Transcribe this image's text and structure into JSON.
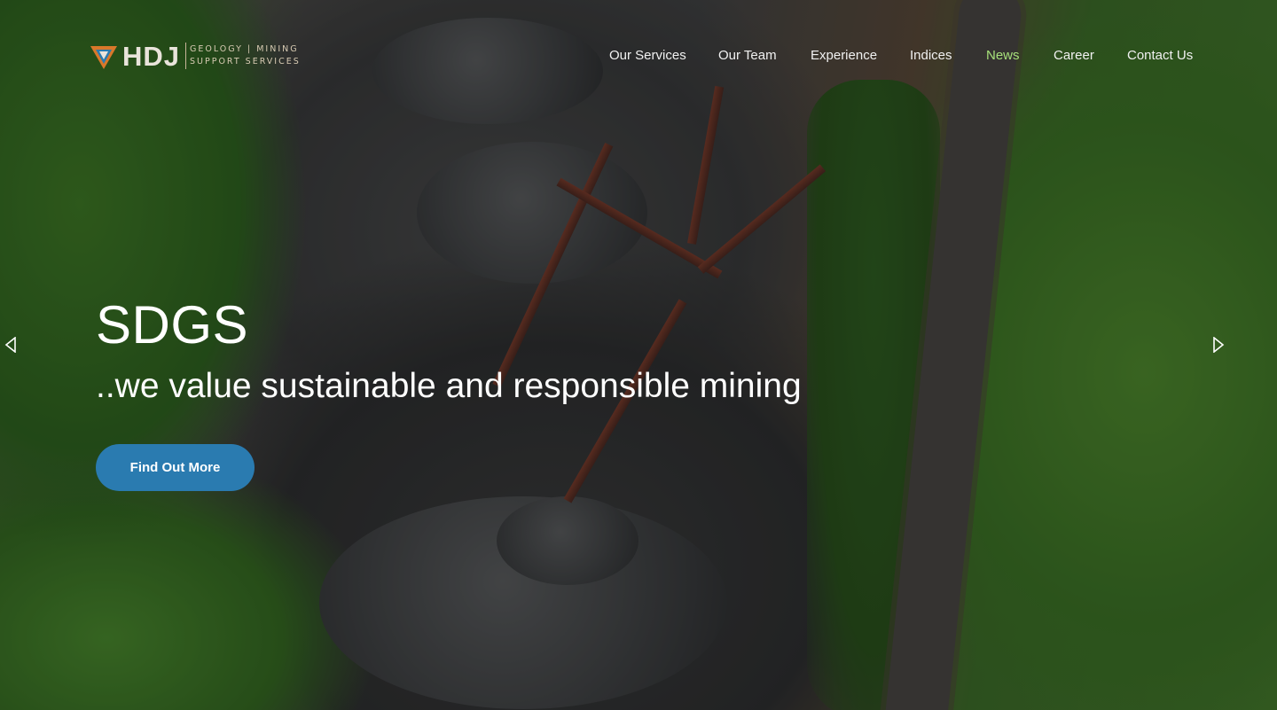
{
  "brand": {
    "wordmark": "HDJ",
    "tagline_line1": "GEOLOGY | MINING",
    "tagline_line2": "SUPPORT SERVICES",
    "logo_icon": "triangle-logo-icon"
  },
  "nav": {
    "items": [
      {
        "label": "Our Services"
      },
      {
        "label": "Our Team"
      },
      {
        "label": "Experience"
      },
      {
        "label": "Indices"
      },
      {
        "label": "News"
      },
      {
        "label": "Career"
      },
      {
        "label": "Contact Us"
      }
    ],
    "active_index": 4
  },
  "hero": {
    "title": "SDGS",
    "subtitle": "..we value sustainable and responsible mining",
    "cta_label": "Find Out More",
    "prev_icon": "chevron-left-icon",
    "next_icon": "chevron-right-icon"
  },
  "colors": {
    "accent": "#2a7bb0",
    "nav_active": "#a6e07a",
    "text": "#ffffff"
  }
}
